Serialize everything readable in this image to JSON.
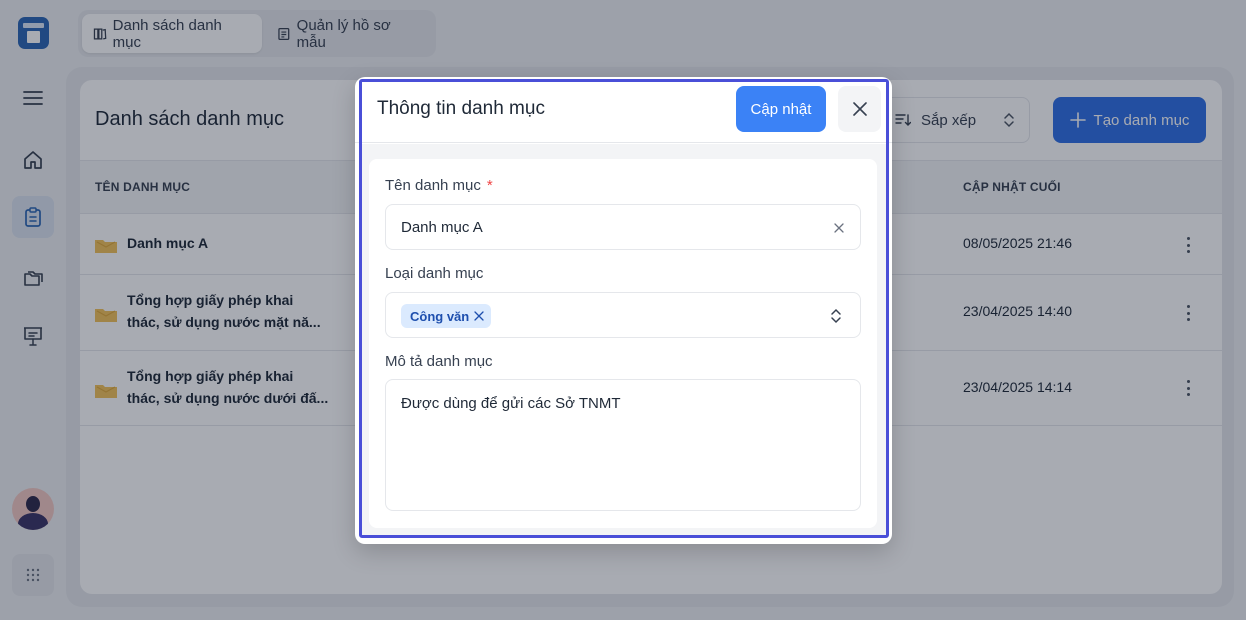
{
  "tabs": [
    {
      "label": "Danh sách danh mục",
      "active": true
    },
    {
      "label": "Quản lý hồ sơ mẫu",
      "active": false
    }
  ],
  "page": {
    "title": "Danh sách danh mục",
    "sort_label": "Sắp xếp",
    "create_label": "Tạo danh mục"
  },
  "table": {
    "columns": [
      "TÊN DANH MỤC",
      "CẬP NHẬT CUỐI"
    ],
    "rows": [
      {
        "name_line1": "Danh mục A",
        "name_line2": "",
        "updated": "08/05/2025 21:46"
      },
      {
        "name_line1": "Tổng hợp giấy phép khai",
        "name_line2": "thác, sử dụng nước mặt nă...",
        "updated": "23/04/2025 14:40"
      },
      {
        "name_line1": "Tổng hợp giấy phép khai",
        "name_line2": "thác, sử dụng nước dưới đấ...",
        "updated": "23/04/2025 14:14"
      }
    ]
  },
  "modal": {
    "title": "Thông tin danh mục",
    "update_label": "Cập nhật",
    "fields": {
      "name_label": "Tên danh mục",
      "required_mark": "*",
      "name_value": "Danh mục A",
      "type_label": "Loại danh mục",
      "type_tag": "Công văn",
      "desc_label": "Mô tả danh mục",
      "desc_value": "Được dùng để gửi các Sở TNMT"
    }
  },
  "colors": {
    "primary": "#3b82f6",
    "create_button": "#2f6fe4",
    "modal_outline": "#4a4fd8",
    "required": "#ef4444",
    "chip_bg": "#dbeafe",
    "folder": "#f2c35a"
  },
  "icons": {
    "menu": "hamburger-icon",
    "home": "home-icon",
    "clipboard": "clipboard-icon",
    "folders": "folders-icon",
    "presentation": "presentation-icon",
    "apps": "grid-dots-icon",
    "sort": "sort-icon",
    "plus": "plus-icon",
    "close": "close-icon",
    "clear": "clear-icon",
    "updown": "chevron-updown-icon"
  }
}
